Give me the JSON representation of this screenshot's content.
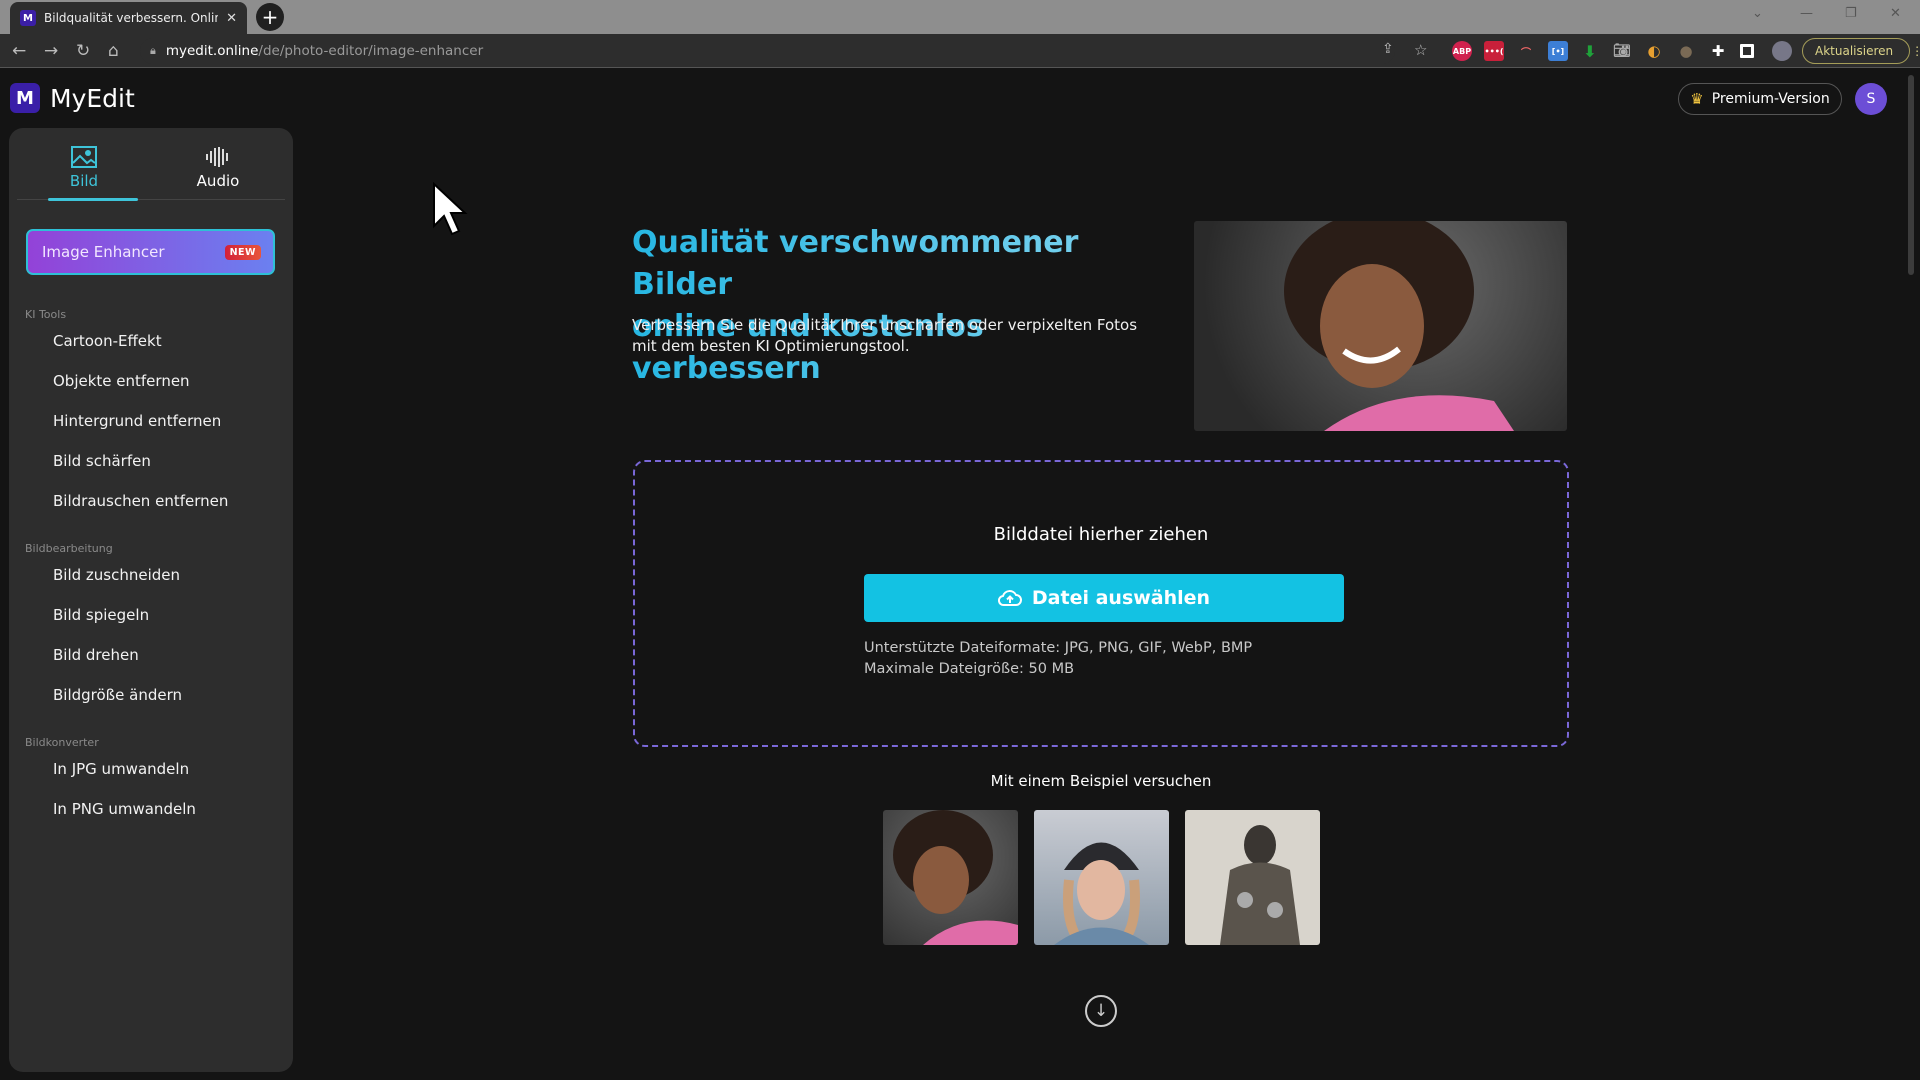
{
  "browser": {
    "tab_title": "Bildqualität verbessern. Online m",
    "tab_favicon": "M",
    "close_glyph": "✕",
    "newtab_glyph": "+",
    "url_domain": "myedit.online",
    "url_path": "/de/photo-editor/image-enhancer",
    "update_label": "Aktualisieren",
    "extensions": [
      "ABP",
      "•••(",
      "rainbow",
      "[•]",
      "download",
      "camera",
      "globe",
      "sphere"
    ]
  },
  "header": {
    "logo_mark": "M",
    "logo_text": "MyEdit",
    "premium_label": "Premium-Version",
    "avatar_initial": "S"
  },
  "sidebar": {
    "modes": [
      {
        "label": "Bild",
        "active": true
      },
      {
        "label": "Audio",
        "active": false
      }
    ],
    "featured": {
      "label": "Image Enhancer",
      "badge": "NEW"
    },
    "sections": [
      {
        "title": "KI Tools",
        "items": [
          "Cartoon-Effekt",
          "Objekte entfernen",
          "Hintergrund entfernen",
          "Bild schärfen",
          "Bildrauschen entfernen"
        ]
      },
      {
        "title": "Bildbearbeitung",
        "items": [
          "Bild zuschneiden",
          "Bild spiegeln",
          "Bild drehen",
          "Bildgröße ändern"
        ]
      },
      {
        "title": "Bildkonverter",
        "items": [
          "In JPG umwandeln",
          "In PNG umwandeln"
        ]
      }
    ]
  },
  "main": {
    "title_line1": "Qualität verschwommener Bilder",
    "title_line2": "online und kostenlos verbessern",
    "description": "Verbessern Sie die Qualität Ihrer unscharfen oder verpixelten Fotos mit dem besten KI Optimierungstool.",
    "dropzone": {
      "title": "Bilddatei hierher ziehen",
      "button_label": "Datei auswählen",
      "formats": "Unterstützte Dateiformate: JPG, PNG, GIF, WebP, BMP",
      "max_size": "Maximale Dateigröße: 50 MB"
    },
    "sample_heading": "Mit einem Beispiel versuchen",
    "samples": [
      "woman-curly-hair",
      "woman-beanie",
      "man-traditional-costume"
    ]
  },
  "colors": {
    "accent": "#13c2e3",
    "brand": "#3a1fa8",
    "featured_start": "#9342d8",
    "featured_end": "#6b80f0"
  }
}
